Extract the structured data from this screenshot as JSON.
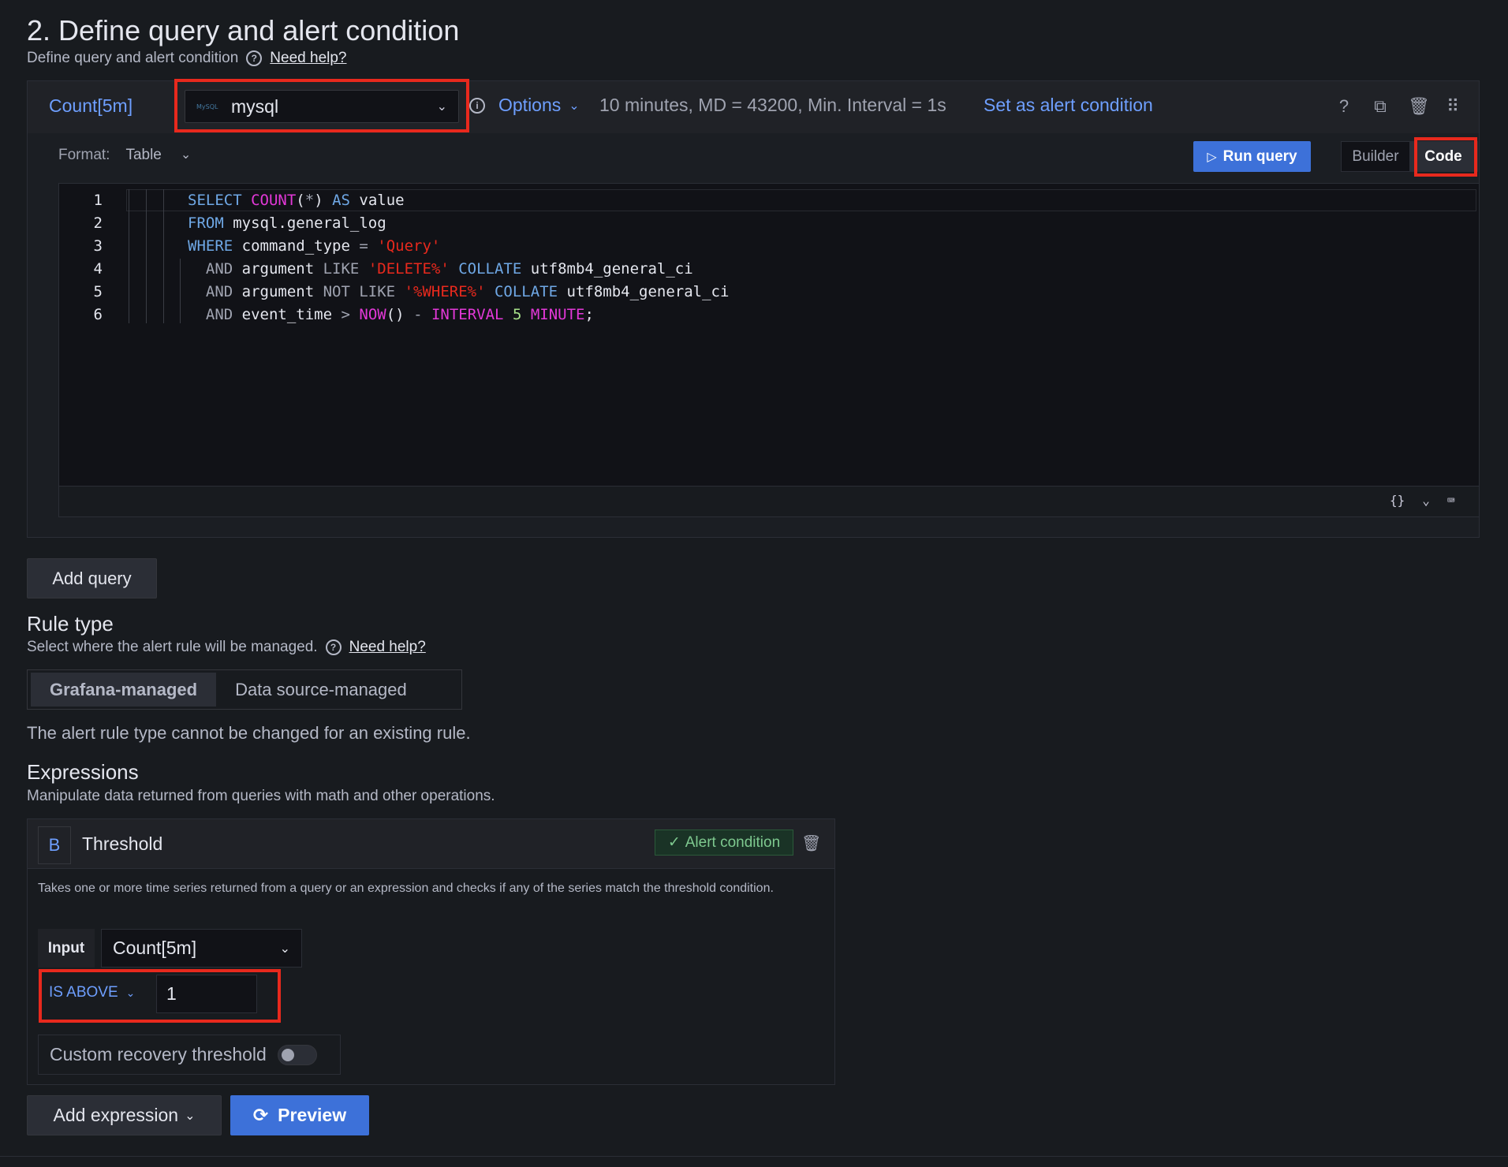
{
  "header": {
    "title": "2. Define query and alert condition",
    "subtitle": "Define query and alert condition",
    "help_link": "Need help?"
  },
  "query": {
    "name": "Count[5m]",
    "datasource": "mysql",
    "datasource_logo_text": "MySQL",
    "options_label": "Options",
    "meta": "10 minutes, MD = 43200, Min. Interval = 1s",
    "set_alert": "Set as alert condition",
    "format_label": "Format:",
    "format_value": "Table",
    "run_label": "Run query",
    "mode_builder": "Builder",
    "mode_code": "Code",
    "line_numbers": [
      "1",
      "2",
      "3",
      "4",
      "5",
      "6"
    ]
  },
  "add_query": "Add query",
  "rule_type": {
    "title": "Rule type",
    "subtitle": "Select where the alert rule will be managed.",
    "help_link": "Need help?",
    "options": [
      "Grafana-managed",
      "Data source-managed"
    ],
    "note": "The alert rule type cannot be changed for an existing rule."
  },
  "expressions": {
    "title": "Expressions",
    "subtitle": "Manipulate data returned from queries with math and other operations.",
    "ref_id": "B",
    "type": "Threshold",
    "alert_badge": "Alert condition",
    "description": "Takes one or more time series returned from a query or an expression and checks if any of the series match the threshold condition.",
    "input_label": "Input",
    "input_value": "Count[5m]",
    "operator": "IS ABOVE",
    "threshold": "1",
    "recovery_label": "Custom recovery threshold"
  },
  "add_expression": "Add expression",
  "preview": "Preview",
  "colors": {
    "accent": "#6e9fff",
    "primary_button": "#3d71d9",
    "highlight": "#e8291d"
  }
}
